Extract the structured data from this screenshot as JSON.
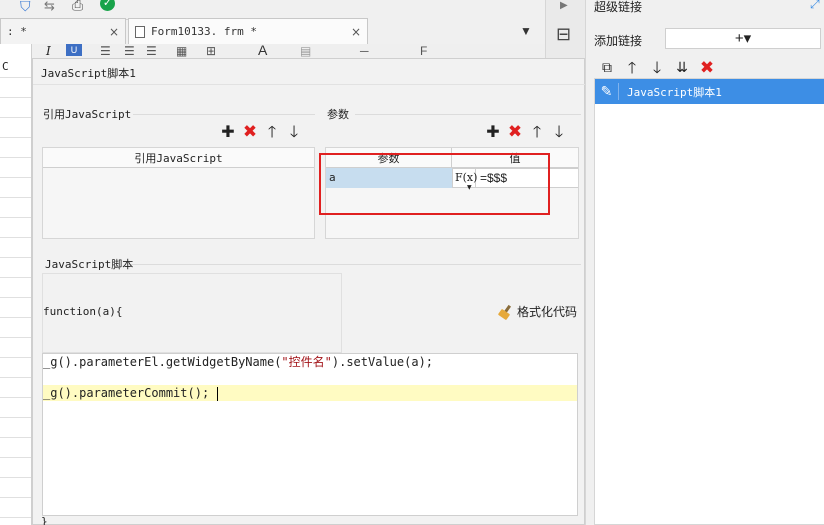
{
  "tabs": [
    {
      "label": ": *",
      "close": "×"
    },
    {
      "label": "Form10133. frm *",
      "close": "×"
    }
  ],
  "sheet": {
    "column_letter": "C"
  },
  "dialog": {
    "title": "JavaScript脚本1",
    "ref_section": {
      "label": "引用JavaScript",
      "column_header": "引用JavaScript"
    },
    "params_section": {
      "label": "参数",
      "columns": [
        "参数",
        "值"
      ],
      "rows": [
        {
          "name": "a",
          "fx_label": "F(x)",
          "value": "=$$$"
        }
      ]
    },
    "script_section": {
      "label": "JavaScript脚本",
      "function_header": "function(a){",
      "format_button": "格式化代码",
      "closing_brace": "}",
      "lines": [
        {
          "pre": "_g().parameterEl.getWidgetByName(",
          "str": "\"控件名\"",
          "post": ").setValue(a);"
        },
        {
          "pre": "_g().parameterCommit();",
          "str": "",
          "post": ""
        }
      ]
    }
  },
  "right_panel": {
    "title": "超级链接",
    "add_label": "添加链接",
    "add_button": "+▾",
    "items": [
      {
        "label": "JavaScript脚本1",
        "selected": true
      }
    ]
  },
  "colors": {
    "accent": "#3d8ee5",
    "highlight_box": "#e02020",
    "current_line": "#fffbc2",
    "param_cell": "#c7ddef"
  }
}
